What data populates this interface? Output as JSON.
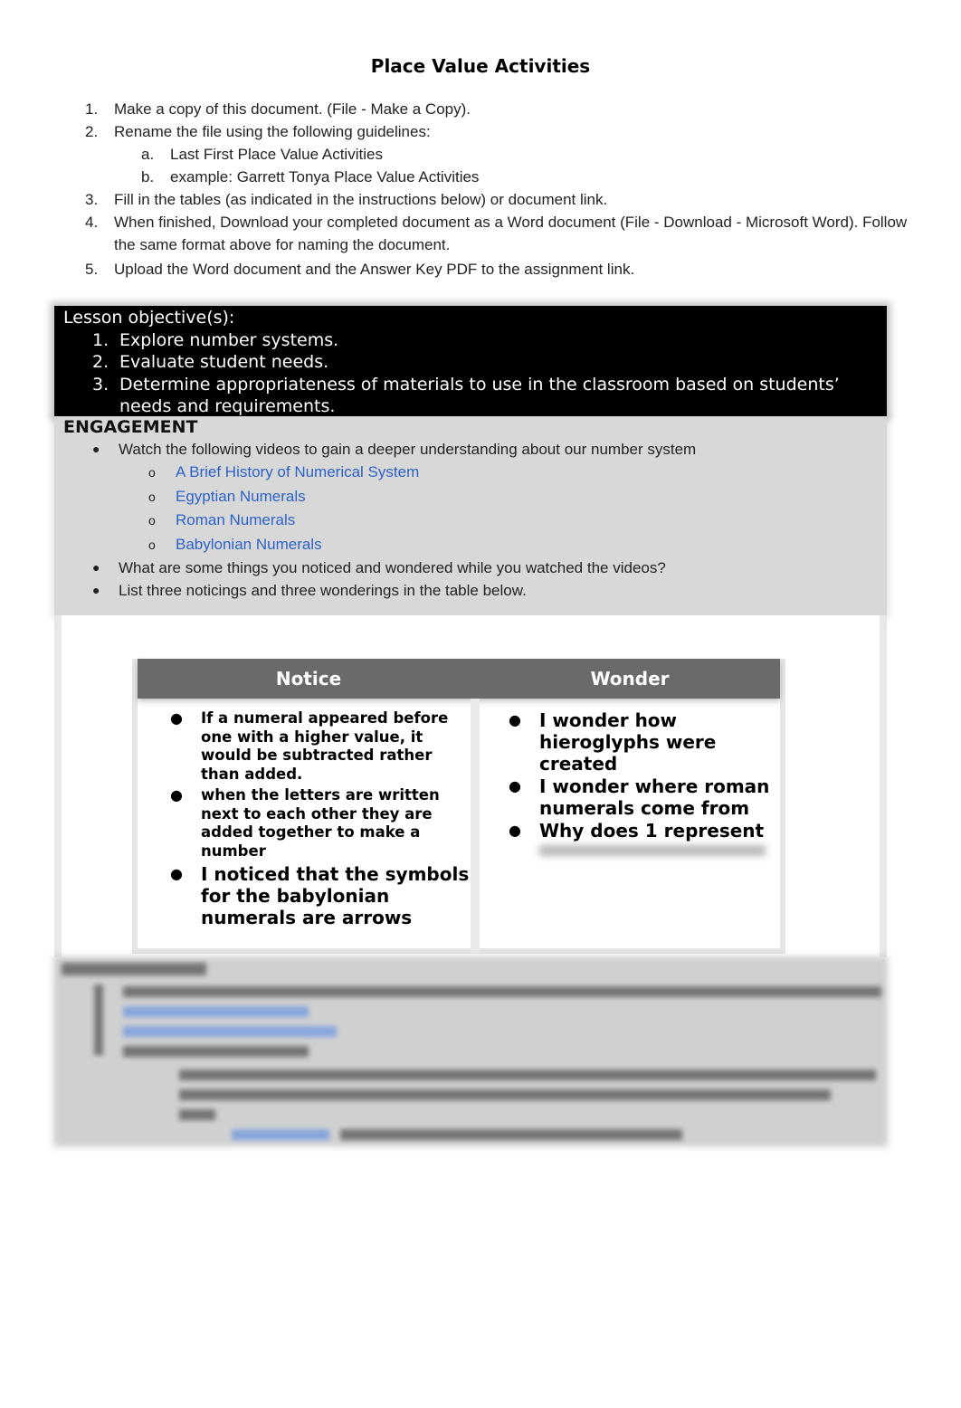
{
  "document": {
    "title": "Place Value Activities"
  },
  "instructions": [
    {
      "num": "1.",
      "text": "Make a copy of this document. (File - Make a Copy)."
    },
    {
      "num": "2.",
      "text": "Rename the file using the following guidelines:"
    },
    {
      "num": "a.",
      "text": "Last First Place Value Activities",
      "sub": true
    },
    {
      "num": "b.",
      "text": "example: Garrett Tonya Place Value Activities",
      "sub": true
    },
    {
      "num": "3.",
      "text": "Fill in the tables (as indicated in the instructions below) or document link."
    },
    {
      "num": "4.",
      "text": "When finished, Download your completed document as a Word document (File - Download - Microsoft Word). Follow the same format above for naming the document."
    },
    {
      "num": "5.",
      "text": "Upload the Word document and the Answer Key PDF to the assignment link."
    }
  ],
  "objectives": {
    "heading": "Lesson objective(s):",
    "items": [
      {
        "num": "1.",
        "text": "Explore number systems."
      },
      {
        "num": "2.",
        "text": "Evaluate student needs."
      },
      {
        "num": "3.",
        "text": "Determine appropriateness of materials to use in the classroom based on students’ needs and requirements."
      }
    ]
  },
  "engagement": {
    "heading": "ENGAGEMENT",
    "bullet_glyph": "●",
    "sub_bullet_glyph": "o",
    "intro": "Watch the following videos to gain a deeper understanding about our number system",
    "links": [
      {
        "label": "A Brief History of Numerical System"
      },
      {
        "label": "Egyptian Numerals"
      },
      {
        "label": "Roman Numerals"
      },
      {
        "label": "Babylonian Numerals"
      }
    ],
    "prompts": [
      "What are some things you noticed and wondered while you watched the videos?",
      "List three noticings and three wonderings in the table below."
    ],
    "link_color": "#2d63c8"
  },
  "table": {
    "headers": {
      "notice": "Notice",
      "wonder": "Wonder"
    },
    "header_color": "#6a6a6a",
    "notice": [
      "If a numeral appeared before one with a higher value, it would be subtracted rather than added.",
      "when the letters are written next to each other they are added together to make a number",
      "I noticed that the symbols for the babylonian numerals are arrows"
    ],
    "wonder": [
      "I wonder how hieroglyphs were created",
      "I wonder where roman numerals come from",
      "Why does 1 represent"
    ]
  }
}
